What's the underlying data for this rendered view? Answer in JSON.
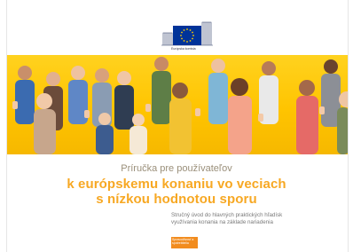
{
  "logo": {
    "icon": "eu-flag-building-icon",
    "organization": "Európska komisia",
    "colors": {
      "flag": "#003399",
      "stars": "#ffcc00"
    }
  },
  "banner": {
    "background": "#ffc400",
    "illustration": "group-of-people-thumbs-up"
  },
  "cover": {
    "subtitle": "Príručka pre používateľov",
    "title_line1": "k európskemu konaniu vo veciach",
    "title_line2": "s nízkou hodnotou sporu",
    "description_line1": "Stručný úvod do hlavných praktických hľadísk",
    "description_line2": "využívania konania na základe nariadenia",
    "badge": "Spravodlivosť a spotrebitelia",
    "accent_color": "#f7a823"
  }
}
